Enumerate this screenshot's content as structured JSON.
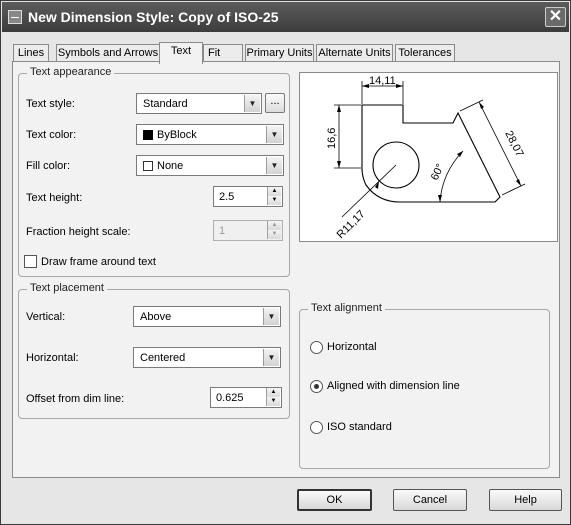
{
  "window": {
    "title": "New Dimension Style: Copy of ISO-25",
    "close_glyph": "✕"
  },
  "tabs": [
    {
      "label": "Lines"
    },
    {
      "label": "Symbols and Arrows"
    },
    {
      "label": "Text",
      "active": true
    },
    {
      "label": "Fit"
    },
    {
      "label": "Primary Units"
    },
    {
      "label": "Alternate Units"
    },
    {
      "label": "Tolerances"
    }
  ],
  "text_appearance": {
    "group_label": "Text appearance",
    "text_style": {
      "label": "Text style:",
      "value": "Standard",
      "browse_label": "..."
    },
    "text_color": {
      "label": "Text color:",
      "value": "ByBlock",
      "swatch_color": "#000000"
    },
    "fill_color": {
      "label": "Fill color:",
      "value": "None",
      "swatch_color": "#ffffff"
    },
    "text_height": {
      "label": "Text height:",
      "value": "2.5"
    },
    "fraction_height_scale": {
      "label": "Fraction height scale:",
      "value": "1",
      "disabled": true
    },
    "draw_frame": {
      "label": "Draw frame around text",
      "checked": false
    }
  },
  "text_placement": {
    "group_label": "Text placement",
    "vertical": {
      "label": "Vertical:",
      "value": "Above"
    },
    "horizontal": {
      "label": "Horizontal:",
      "value": "Centered"
    },
    "offset": {
      "label": "Offset from dim line:",
      "value": "0.625"
    }
  },
  "text_alignment": {
    "group_label": "Text alignment",
    "options": [
      {
        "label": "Horizontal",
        "selected": false
      },
      {
        "label": "Aligned with dimension line",
        "selected": true
      },
      {
        "label": "ISO standard",
        "selected": false
      }
    ]
  },
  "preview": {
    "dim_top": "14,11",
    "dim_left": "16,6",
    "dim_right": "28,07",
    "dim_angle": "60°",
    "dim_radius": "R11,17"
  },
  "buttons": {
    "ok": "OK",
    "cancel": "Cancel",
    "help": "Help"
  }
}
